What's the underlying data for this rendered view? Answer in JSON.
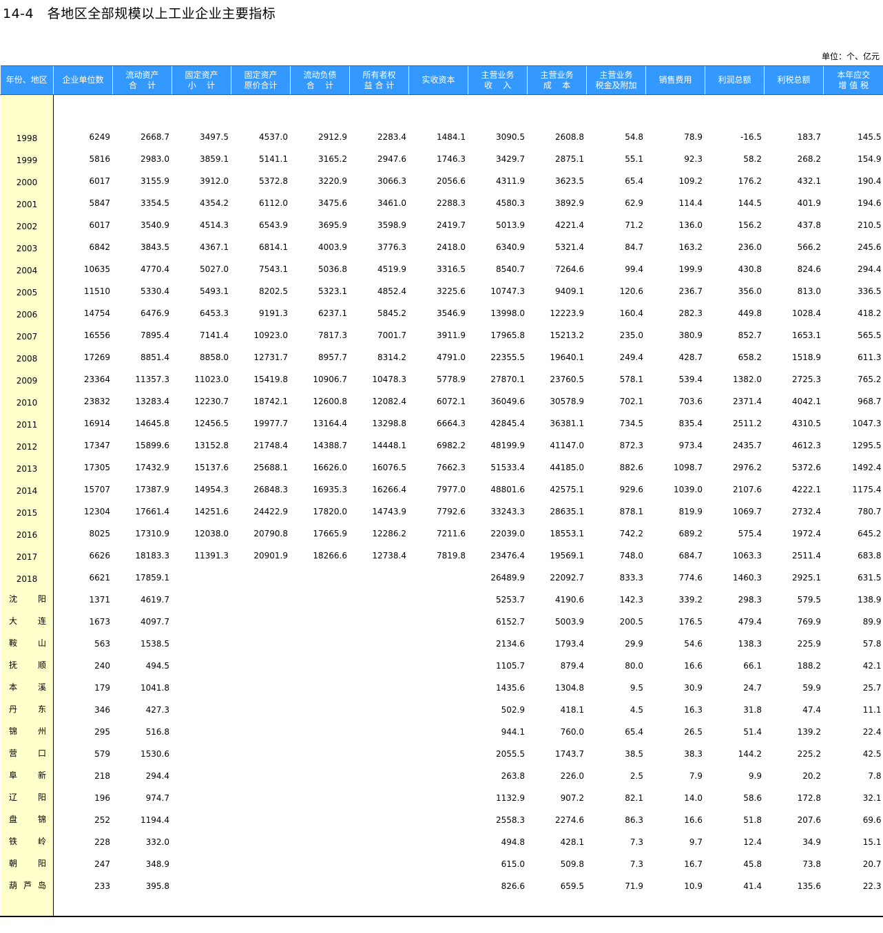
{
  "title": "14-4   各地区全部规模以上工业企业主要指标",
  "unit": "单位：个、亿元",
  "colors": {
    "header_bg": "#3399ff",
    "label_bg": "#ffffcc"
  },
  "headers": [
    [
      "年份、地区"
    ],
    [
      "企业单位数"
    ],
    [
      "流动资产",
      "合    计"
    ],
    [
      "固定资产",
      "小    计"
    ],
    [
      "固定资产",
      "原价合计"
    ],
    [
      "流动负债",
      "合    计"
    ],
    [
      "所有者权",
      "益 合 计"
    ],
    [
      "实收资本"
    ],
    [
      "主营业务",
      "收    入"
    ],
    [
      "主营业务",
      "成    本"
    ],
    [
      "主营业务",
      "税金及附加"
    ],
    [
      "销售费用"
    ],
    [
      "利润总额"
    ],
    [
      "利税总额"
    ],
    [
      "本年应交",
      "增 值 税"
    ]
  ],
  "rows": [
    {
      "label": "1998",
      "type": "year",
      "values": [
        "6249",
        "2668.7",
        "3497.5",
        "4537.0",
        "2912.9",
        "2283.4",
        "1484.1",
        "3090.5",
        "2608.8",
        "54.8",
        "78.9",
        "-16.5",
        "183.7",
        "145.5"
      ]
    },
    {
      "label": "1999",
      "type": "year",
      "values": [
        "5816",
        "2983.0",
        "3859.1",
        "5141.1",
        "3165.2",
        "2947.6",
        "1746.3",
        "3429.7",
        "2875.1",
        "55.1",
        "92.3",
        "58.2",
        "268.2",
        "154.9"
      ]
    },
    {
      "label": "2000",
      "type": "year",
      "values": [
        "6017",
        "3155.9",
        "3912.0",
        "5372.8",
        "3220.9",
        "3066.3",
        "2056.6",
        "4311.9",
        "3623.5",
        "65.4",
        "109.2",
        "176.2",
        "432.1",
        "190.4"
      ]
    },
    {
      "label": "2001",
      "type": "year",
      "values": [
        "5847",
        "3354.5",
        "4354.2",
        "6112.0",
        "3475.6",
        "3461.0",
        "2288.3",
        "4580.3",
        "3892.9",
        "62.9",
        "114.4",
        "144.5",
        "401.9",
        "194.6"
      ]
    },
    {
      "label": "2002",
      "type": "year",
      "values": [
        "6017",
        "3540.9",
        "4514.3",
        "6543.9",
        "3695.9",
        "3598.9",
        "2419.7",
        "5013.9",
        "4221.4",
        "71.2",
        "136.0",
        "156.2",
        "437.8",
        "210.5"
      ]
    },
    {
      "label": "2003",
      "type": "year",
      "values": [
        "6842",
        "3843.5",
        "4367.1",
        "6814.1",
        "4003.9",
        "3776.3",
        "2418.0",
        "6340.9",
        "5321.4",
        "84.7",
        "163.2",
        "236.0",
        "566.2",
        "245.6"
      ]
    },
    {
      "label": "2004",
      "type": "year",
      "values": [
        "10635",
        "4770.4",
        "5027.0",
        "7543.1",
        "5036.8",
        "4519.9",
        "3316.5",
        "8540.7",
        "7264.6",
        "99.4",
        "199.9",
        "430.8",
        "824.6",
        "294.4"
      ]
    },
    {
      "label": "2005",
      "type": "year",
      "values": [
        "11510",
        "5330.4",
        "5493.1",
        "8202.5",
        "5323.1",
        "4852.4",
        "3225.6",
        "10747.3",
        "9409.1",
        "120.6",
        "236.7",
        "356.0",
        "813.0",
        "336.5"
      ]
    },
    {
      "label": "2006",
      "type": "year",
      "values": [
        "14754",
        "6476.9",
        "6453.3",
        "9191.3",
        "6237.1",
        "5845.2",
        "3546.9",
        "13998.0",
        "12223.9",
        "160.4",
        "282.3",
        "449.8",
        "1028.4",
        "418.2"
      ]
    },
    {
      "label": "2007",
      "type": "year",
      "values": [
        "16556",
        "7895.4",
        "7141.4",
        "10923.0",
        "7817.3",
        "7001.7",
        "3911.9",
        "17965.8",
        "15213.2",
        "235.0",
        "380.9",
        "852.7",
        "1653.1",
        "565.5"
      ]
    },
    {
      "label": "2008",
      "type": "year",
      "values": [
        "17269",
        "8851.4",
        "8858.0",
        "12731.7",
        "8957.7",
        "8314.2",
        "4791.0",
        "22355.5",
        "19640.1",
        "249.4",
        "428.7",
        "658.2",
        "1518.9",
        "611.3"
      ]
    },
    {
      "label": "2009",
      "type": "year",
      "values": [
        "23364",
        "11357.3",
        "11023.0",
        "15419.8",
        "10906.7",
        "10478.3",
        "5778.9",
        "27870.1",
        "23760.5",
        "578.1",
        "539.4",
        "1382.0",
        "2725.3",
        "765.2"
      ]
    },
    {
      "label": "2010",
      "type": "year",
      "values": [
        "23832",
        "13283.4",
        "12230.7",
        "18742.1",
        "12600.8",
        "12082.4",
        "6072.1",
        "36049.6",
        "30578.9",
        "702.1",
        "703.6",
        "2371.4",
        "4042.1",
        "968.7"
      ]
    },
    {
      "label": "2011",
      "type": "year",
      "values": [
        "16914",
        "14645.8",
        "12456.5",
        "19977.7",
        "13164.4",
        "13298.8",
        "6664.3",
        "42845.4",
        "36381.1",
        "734.5",
        "835.4",
        "2511.2",
        "4310.5",
        "1047.3"
      ]
    },
    {
      "label": "2012",
      "type": "year",
      "values": [
        "17347",
        "15899.6",
        "13152.8",
        "21748.4",
        "14388.7",
        "14448.1",
        "6982.2",
        "48199.9",
        "41147.0",
        "872.3",
        "973.4",
        "2435.7",
        "4612.3",
        "1295.5"
      ]
    },
    {
      "label": "2013",
      "type": "year",
      "values": [
        "17305",
        "17432.9",
        "15137.6",
        "25688.1",
        "16626.0",
        "16076.5",
        "7662.3",
        "51533.4",
        "44185.0",
        "882.6",
        "1098.7",
        "2976.2",
        "5372.6",
        "1492.4"
      ]
    },
    {
      "label": "2014",
      "type": "year",
      "values": [
        "15707",
        "17387.9",
        "14954.3",
        "26848.3",
        "16935.3",
        "16266.4",
        "7977.0",
        "48801.6",
        "42575.1",
        "929.6",
        "1039.0",
        "2107.6",
        "4222.1",
        "1175.4"
      ]
    },
    {
      "label": "2015",
      "type": "year",
      "values": [
        "12304",
        "17661.4",
        "14251.6",
        "24422.9",
        "17820.0",
        "14743.9",
        "7792.6",
        "33243.3",
        "28635.1",
        "878.1",
        "819.9",
        "1069.7",
        "2732.4",
        "780.7"
      ]
    },
    {
      "label": "2016",
      "type": "year",
      "values": [
        "8025",
        "17310.9",
        "12038.0",
        "20790.8",
        "17665.9",
        "12286.2",
        "7211.6",
        "22039.0",
        "18553.1",
        "742.2",
        "689.2",
        "575.4",
        "1972.4",
        "645.2"
      ]
    },
    {
      "label": "2017",
      "type": "year",
      "values": [
        "6626",
        "18183.3",
        "11391.3",
        "20901.9",
        "18266.6",
        "12738.4",
        "7819.8",
        "23476.4",
        "19569.1",
        "748.0",
        "684.7",
        "1063.3",
        "2511.4",
        "683.8"
      ]
    },
    {
      "label": "2018",
      "type": "year",
      "values": [
        "6621",
        "17859.1",
        "",
        "",
        "",
        "",
        "",
        "26489.9",
        "22092.7",
        "833.3",
        "774.6",
        "1460.3",
        "2925.1",
        "631.5"
      ]
    },
    {
      "label": "沈阳",
      "type": "city",
      "values": [
        "1371",
        "4619.7",
        "",
        "",
        "",
        "",
        "",
        "5253.7",
        "4190.6",
        "142.3",
        "339.2",
        "298.3",
        "579.5",
        "138.9"
      ]
    },
    {
      "label": "大连",
      "type": "city",
      "values": [
        "1673",
        "4097.7",
        "",
        "",
        "",
        "",
        "",
        "6152.7",
        "5003.9",
        "200.5",
        "176.5",
        "479.4",
        "769.9",
        "89.9"
      ]
    },
    {
      "label": "鞍山",
      "type": "city",
      "values": [
        "563",
        "1538.5",
        "",
        "",
        "",
        "",
        "",
        "2134.6",
        "1793.4",
        "29.9",
        "54.6",
        "138.3",
        "225.9",
        "57.8"
      ]
    },
    {
      "label": "抚顺",
      "type": "city",
      "values": [
        "240",
        "494.5",
        "",
        "",
        "",
        "",
        "",
        "1105.7",
        "879.4",
        "80.0",
        "16.6",
        "66.1",
        "188.2",
        "42.1"
      ]
    },
    {
      "label": "本溪",
      "type": "city",
      "values": [
        "179",
        "1041.8",
        "",
        "",
        "",
        "",
        "",
        "1435.6",
        "1304.8",
        "9.5",
        "30.9",
        "24.7",
        "59.9",
        "25.7"
      ]
    },
    {
      "label": "丹东",
      "type": "city",
      "values": [
        "346",
        "427.3",
        "",
        "",
        "",
        "",
        "",
        "502.9",
        "418.1",
        "4.5",
        "16.3",
        "31.8",
        "47.4",
        "11.1"
      ]
    },
    {
      "label": "锦州",
      "type": "city",
      "values": [
        "295",
        "516.8",
        "",
        "",
        "",
        "",
        "",
        "944.1",
        "760.0",
        "65.4",
        "26.5",
        "51.4",
        "139.2",
        "22.4"
      ]
    },
    {
      "label": "营口",
      "type": "city",
      "values": [
        "579",
        "1530.6",
        "",
        "",
        "",
        "",
        "",
        "2055.5",
        "1743.7",
        "38.5",
        "38.3",
        "144.2",
        "225.2",
        "42.5"
      ]
    },
    {
      "label": "阜新",
      "type": "city",
      "values": [
        "218",
        "294.4",
        "",
        "",
        "",
        "",
        "",
        "263.8",
        "226.0",
        "2.5",
        "7.9",
        "9.9",
        "20.2",
        "7.8"
      ]
    },
    {
      "label": "辽阳",
      "type": "city",
      "values": [
        "196",
        "974.7",
        "",
        "",
        "",
        "",
        "",
        "1132.9",
        "907.2",
        "82.1",
        "14.0",
        "58.6",
        "172.8",
        "32.1"
      ]
    },
    {
      "label": "盘锦",
      "type": "city",
      "values": [
        "252",
        "1194.4",
        "",
        "",
        "",
        "",
        "",
        "2558.3",
        "2274.6",
        "86.3",
        "16.6",
        "51.8",
        "207.6",
        "69.6"
      ]
    },
    {
      "label": "铁岭",
      "type": "city",
      "values": [
        "228",
        "332.0",
        "",
        "",
        "",
        "",
        "",
        "494.8",
        "428.1",
        "7.3",
        "9.7",
        "12.4",
        "34.9",
        "15.1"
      ]
    },
    {
      "label": "朝阳",
      "type": "city",
      "values": [
        "247",
        "348.9",
        "",
        "",
        "",
        "",
        "",
        "615.0",
        "509.8",
        "7.3",
        "16.7",
        "45.8",
        "73.8",
        "20.7"
      ]
    },
    {
      "label": "葫芦岛",
      "type": "city",
      "values": [
        "233",
        "395.8",
        "",
        "",
        "",
        "",
        "",
        "826.6",
        "659.5",
        "71.9",
        "10.9",
        "41.4",
        "135.6",
        "22.3"
      ]
    }
  ]
}
